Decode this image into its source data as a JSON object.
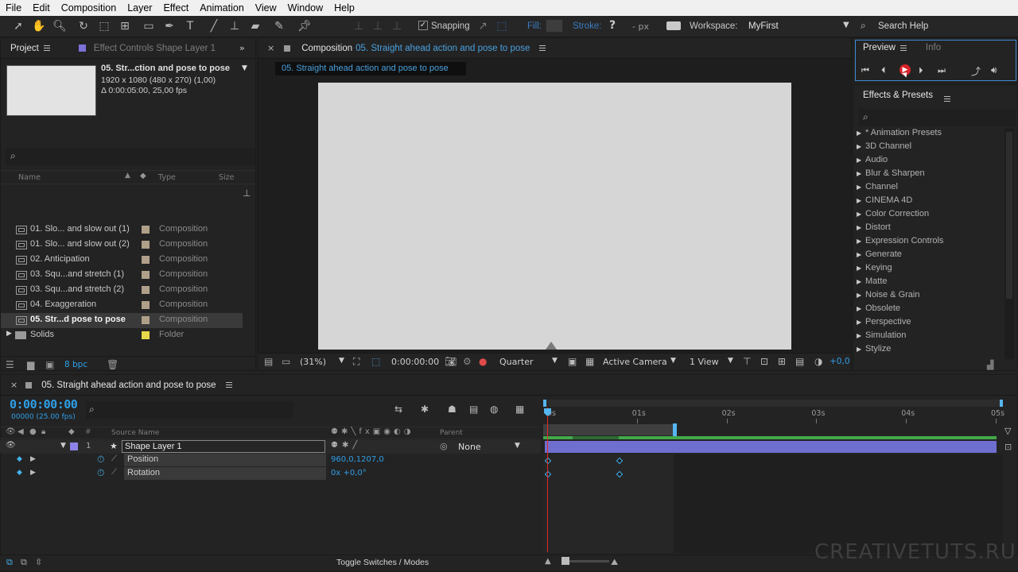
{
  "menu": [
    "File",
    "Edit",
    "Composition",
    "Layer",
    "Effect",
    "Animation",
    "View",
    "Window",
    "Help"
  ],
  "toolbar": {
    "snapping_label": "Snapping",
    "fill_label": "Fill:",
    "stroke_label": "Stroke:",
    "stroke_px": "- px",
    "workspace_label": "Workspace:",
    "workspace_value": "MyFirst",
    "search_help": "Search Help"
  },
  "project": {
    "tab_project": "Project",
    "tab_effect_controls": "Effect Controls Shape Layer 1",
    "comp_name": "05. Str...ction and pose to pose",
    "comp_size": "1920 x 1080  (480 x 270) (1,00)",
    "comp_duration": "Δ 0:00:05:00, 25,00 fps",
    "search_placeholder": "",
    "col_name": "Name",
    "col_type": "Type",
    "col_size": "Size",
    "items": [
      {
        "name": "01. Slo... and slow out (1)",
        "type": "Composition",
        "color": "#b0a08a"
      },
      {
        "name": "01. Slo... and slow out (2)",
        "type": "Composition",
        "color": "#b0a08a"
      },
      {
        "name": "02. Anticipation",
        "type": "Composition",
        "color": "#b0a08a"
      },
      {
        "name": "03. Squ...and stretch (1)",
        "type": "Composition",
        "color": "#b0a08a"
      },
      {
        "name": "03. Squ...and stretch (2)",
        "type": "Composition",
        "color": "#b0a08a"
      },
      {
        "name": "04. Exaggeration",
        "type": "Composition",
        "color": "#b0a08a"
      },
      {
        "name": "05. Str...d pose to pose",
        "type": "Composition",
        "color": "#b0a08a"
      },
      {
        "name": "Solids",
        "type": "Folder",
        "color": "#e6d84a"
      }
    ],
    "bpc": "8 bpc"
  },
  "composition": {
    "tab_label": "Composition",
    "tab_name": "05. Straight ahead action and pose to pose",
    "subtab": "05. Straight ahead action and pose to pose",
    "zoom": "(31%)",
    "timecode": "0:00:00:00",
    "resolution": "Quarter",
    "camera": "Active Camera",
    "views": "1 View",
    "exposure": "+0,0"
  },
  "preview": {
    "tab_preview": "Preview",
    "tab_info": "Info"
  },
  "effects": {
    "title": "Effects & Presets",
    "items": [
      "* Animation Presets",
      "3D Channel",
      "Audio",
      "Blur & Sharpen",
      "Channel",
      "CINEMA 4D",
      "Color Correction",
      "Distort",
      "Expression Controls",
      "Generate",
      "Keying",
      "Matte",
      "Noise & Grain",
      "Obsolete",
      "Perspective",
      "Simulation",
      "Stylize"
    ]
  },
  "timeline": {
    "tab_name": "05. Straight ahead action and pose to pose",
    "timecode": "0:00:00:00",
    "frames": "00000 (25.00 fps)",
    "col_source_name": "Source Name",
    "col_parent": "Parent",
    "layer_number": "1",
    "layer_name": "Shape Layer 1",
    "parent_value": "None",
    "props": [
      {
        "name": "Position",
        "value": "960,0,1207,0"
      },
      {
        "name": "Rotation",
        "value": "0x +0,0°"
      }
    ],
    "ticks": [
      "0s",
      "01s",
      "02s",
      "03s",
      "04s",
      "05s"
    ],
    "toggle_label": "Toggle Switches / Modes"
  },
  "watermark": "CREATIVETUTS.RU"
}
